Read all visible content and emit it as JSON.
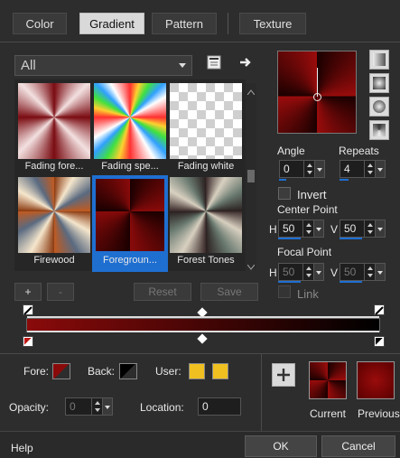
{
  "tabs": [
    {
      "label": "Color"
    },
    {
      "label": "Gradient"
    },
    {
      "label": "Pattern"
    },
    {
      "label": "Texture"
    }
  ],
  "library": {
    "category": "All",
    "thumbnails": [
      {
        "caption": "Fading fore..."
      },
      {
        "caption": "Fading spe..."
      },
      {
        "caption": "Fading white"
      },
      {
        "caption": "Firewood"
      },
      {
        "caption": "Foregroun..."
      },
      {
        "caption": "Forest Tones"
      }
    ],
    "add_label": "+",
    "remove_label": "-",
    "reset_label": "Reset",
    "save_label": "Save"
  },
  "controls": {
    "angle_label": "Angle",
    "angle_value": "0",
    "repeats_label": "Repeats",
    "repeats_value": "4",
    "invert_label": "Invert",
    "center_point_label": "Center Point",
    "center_h_label": "H",
    "center_h_value": "50",
    "center_v_label": "V",
    "center_v_value": "50",
    "focal_point_label": "Focal Point",
    "focal_h_label": "H",
    "focal_h_value": "50",
    "focal_v_label": "V",
    "focal_v_value": "50",
    "link_label": "Link"
  },
  "editor": {
    "fore_label": "Fore:",
    "back_label": "Back:",
    "user_label": "User:",
    "opacity_label": "Opacity:",
    "opacity_value": "0",
    "location_label": "Location:",
    "location_value": "0",
    "add_label": "+",
    "current_label": "Current",
    "previous_label": "Previous"
  },
  "footer": {
    "help_label": "Help",
    "ok_label": "OK",
    "cancel_label": "Cancel"
  },
  "colors": {
    "foreground": "#8a0a0a",
    "background": "#000000",
    "user": "#f0c020",
    "accent": "#1f6fd1"
  }
}
